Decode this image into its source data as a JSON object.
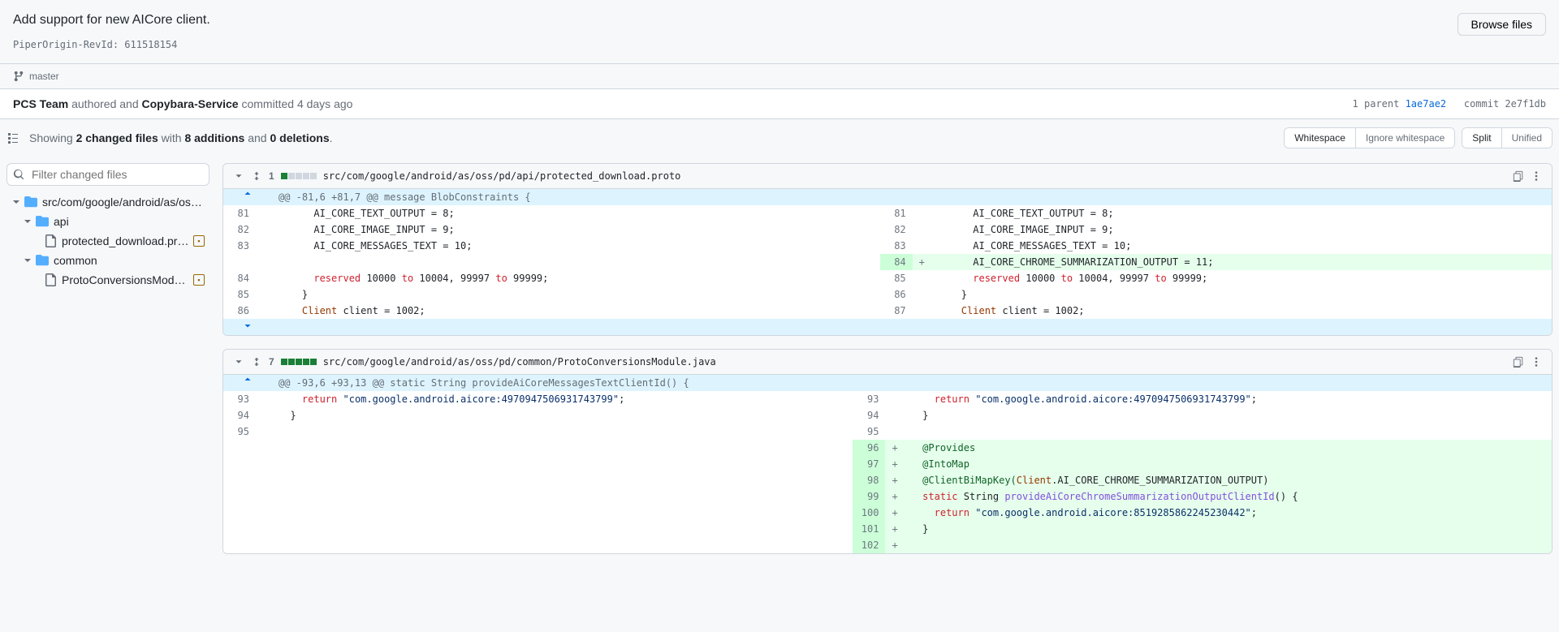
{
  "header": {
    "title": "Add support for new AICore client.",
    "subtitle": "PiperOrigin-RevId: 611518154",
    "browse_files": "Browse files"
  },
  "branch": {
    "name": "master"
  },
  "meta": {
    "author": "PCS Team",
    "authored_word": " authored and ",
    "committer": "Copybara-Service",
    "committed_word": " committed ",
    "time": "4 days ago",
    "parent_label": "1 parent ",
    "parent_sha": "1ae7ae2",
    "commit_label": "commit ",
    "commit_sha": "2e7f1db"
  },
  "toolbar": {
    "summary_prefix": "Showing ",
    "files_count": "2 changed files",
    "with": " with ",
    "additions": "8 additions",
    "and": " and ",
    "deletions": "0 deletions",
    "period": ".",
    "whitespace": "Whitespace",
    "ignore_ws": "Ignore whitespace",
    "split": "Split",
    "unified": "Unified"
  },
  "filter": {
    "placeholder": "Filter changed files"
  },
  "tree": {
    "root": "src/com/google/android/as/oss/...",
    "api": "api",
    "api_file": "protected_download.proto",
    "common": "common",
    "common_file": "ProtoConversionsModule.j..."
  },
  "file1": {
    "stat": "1",
    "path": "src/com/google/android/as/oss/pd/api/protected_download.proto",
    "hunk": "@@ -81,6 +81,7 @@ message BlobConstraints {",
    "lines": {
      "l81": "      AI_CORE_TEXT_OUTPUT = 8;",
      "l82": "      AI_CORE_IMAGE_INPUT = 9;",
      "l83": "      AI_CORE_MESSAGES_TEXT = 10;",
      "add84": "      AI_CORE_CHROME_SUMMARIZATION_OUTPUT = 11;",
      "l84a": "      ",
      "l84b": " 10000 ",
      "l84c": " 10004, 99997 ",
      "l84d": " 99999;",
      "l85": "    }",
      "l86a": "    ",
      "l86b": " client = 1002;",
      "kw_reserved": "reserved",
      "kw_to": "to",
      "kw_Client": "Client"
    },
    "nums": {
      "o81": "81",
      "o82": "82",
      "o83": "83",
      "o84": "84",
      "o85": "85",
      "o86": "86",
      "n81": "81",
      "n82": "82",
      "n83": "83",
      "n84": "84",
      "n85": "85",
      "n86": "86",
      "n87": "87"
    }
  },
  "file2": {
    "stat": "7",
    "path": "src/com/google/android/as/oss/pd/common/ProtoConversionsModule.java",
    "hunk": "@@ -93,6 +93,13 @@ static String provideAiCoreMessagesTextClientId() {",
    "lines": {
      "l93a": "    ",
      "l93b": " ",
      "l93c": ";",
      "str93": "\"com.google.android.aicore:4970947506931743799\"",
      "l94": "  }",
      "l95": "",
      "a96": "  @Provides",
      "a97": "  @IntoMap",
      "a98a": "  @ClientBiMapKey(",
      "a98b": "Client",
      "a98c": ".AI_CORE_CHROME_SUMMARIZATION_OUTPUT)",
      "a99a": "  ",
      "a99b": " String ",
      "a99c": "() {",
      "def99": "provideAiCoreChromeSummarizationOutputClientId",
      "a100a": "    ",
      "a100b": " ",
      "a100c": ";",
      "str100": "\"com.google.android.aicore:8519285862245230442\"",
      "a101": "  }",
      "a102": "",
      "kw_return": "return",
      "kw_static": "static"
    },
    "nums": {
      "o93": "93",
      "o94": "94",
      "o95": "95",
      "n93": "93",
      "n94": "94",
      "n95": "95",
      "n96": "96",
      "n97": "97",
      "n98": "98",
      "n99": "99",
      "n100": "100",
      "n101": "101",
      "n102": "102"
    }
  }
}
